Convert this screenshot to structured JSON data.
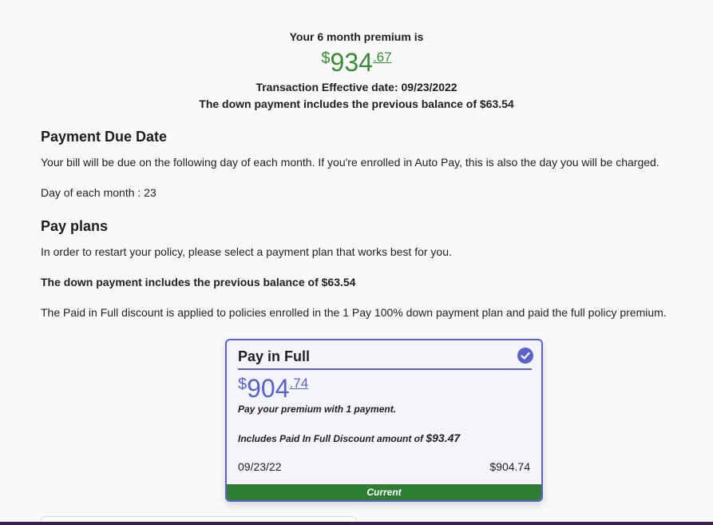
{
  "summary": {
    "heading": "Your 6 month premium is",
    "price_currency": "$",
    "price_whole": "934",
    "price_cents": ".67",
    "effective_date": "Transaction Effective date: 09/23/2022",
    "previous_balance": "The down payment includes the previous balance of $63.54"
  },
  "due_date": {
    "title": "Payment Due Date",
    "description": "Your bill will be due on the following day of each month. If you're enrolled in Auto Pay, this is also the day you will be charged.",
    "day_text": "Day of each month : 23"
  },
  "pay_plans": {
    "title": "Pay plans",
    "intro": "In order to restart your policy, please select a payment plan that works best for you.",
    "previous_balance": "The down payment includes the previous balance of $63.54",
    "discount_note": "The Paid in Full discount is applied to policies enrolled in the 1 Pay 100% down payment plan and paid the full policy premium."
  },
  "plan_card": {
    "title": "Pay in Full",
    "price_currency": "$",
    "price_whole": "904",
    "price_cents": ".74",
    "subtitle": "Pay your premium with 1 payment.",
    "discount_label": "Includes Paid In Full Discount amount of ",
    "discount_amount": "$93.47",
    "date": "09/23/22",
    "amount": "$904.74",
    "status": "Current",
    "selected": true
  },
  "colors": {
    "accent": "#5b63c8",
    "price_green": "#3a8a3a",
    "status_green": "#2e7d32"
  }
}
